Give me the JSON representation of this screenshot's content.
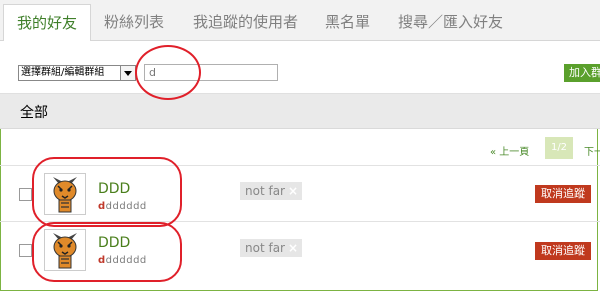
{
  "tabs": [
    {
      "label": "我的好友",
      "active": true
    },
    {
      "label": "粉絲列表",
      "active": false
    },
    {
      "label": "我追蹤的使用者",
      "active": false
    },
    {
      "label": "黑名單",
      "active": false
    },
    {
      "label": "搜尋／匯入好友",
      "active": false
    }
  ],
  "toolbar": {
    "group_select": "選擇群組/編輯群組",
    "search_value": "d",
    "add_button": "加入群"
  },
  "group": {
    "title": "全部"
  },
  "pager": {
    "prev": "« 上一頁",
    "current": "1/2",
    "next": "下一"
  },
  "friends": [
    {
      "name": "DDD",
      "handle_first": "d",
      "handle_rest": "dddddd",
      "tag": "not far",
      "tag_remove": "×",
      "action": "取消追蹤"
    },
    {
      "name": "DDD",
      "handle_first": "d",
      "handle_rest": "dddddd",
      "tag": "not far",
      "tag_remove": "×",
      "action": "取消追蹤"
    }
  ],
  "colors": {
    "accent": "#5aa02c",
    "annotation": "#e0202a",
    "danger": "#c0391e"
  },
  "icons": [
    "chevron-down-icon",
    "tiger-avatar-icon",
    "remove-tag-icon"
  ]
}
